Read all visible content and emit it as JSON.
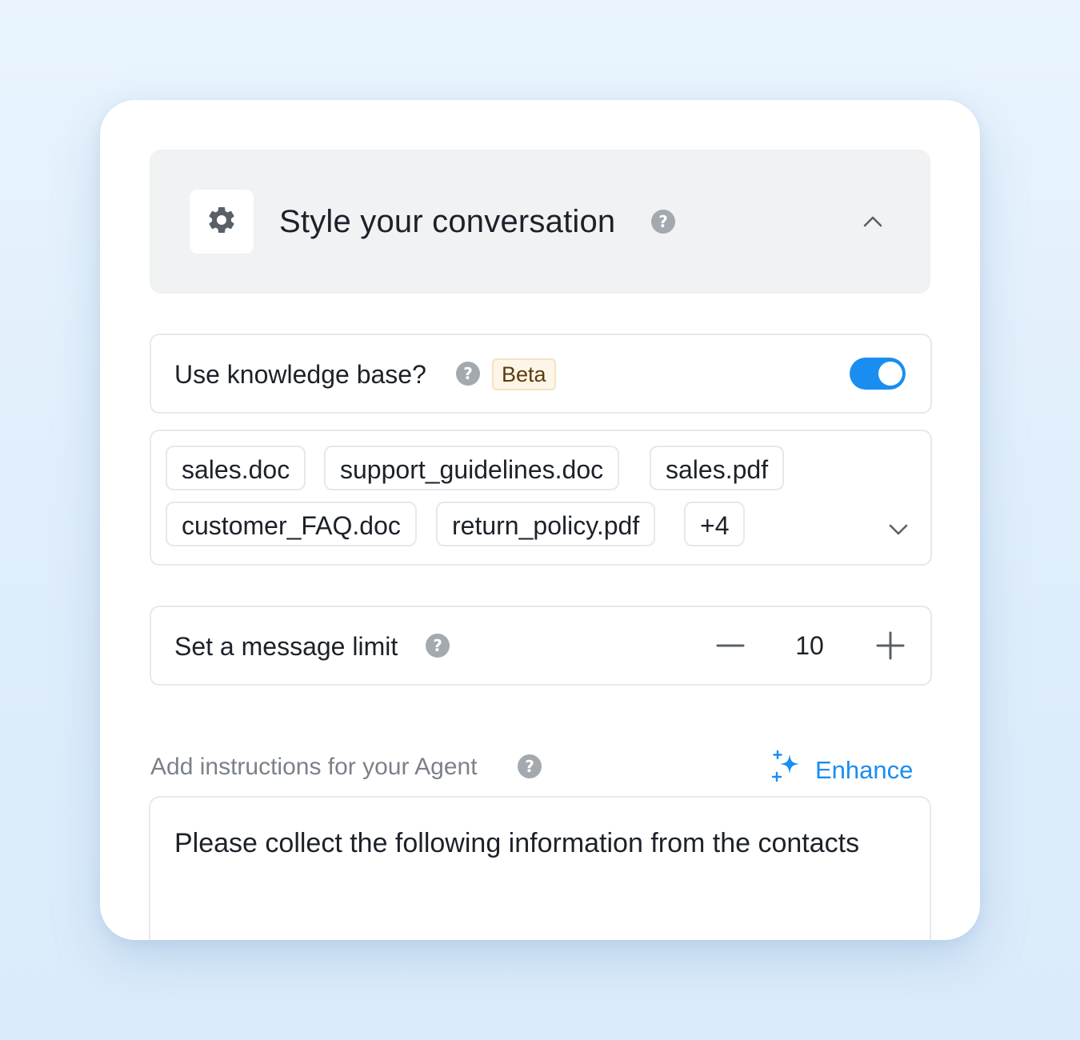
{
  "section": {
    "title": "Style your conversation",
    "help_glyph": "?",
    "icon": "gear-icon",
    "collapse_icon": "chevron-up-icon"
  },
  "knowledge_base": {
    "label": "Use knowledge base?",
    "help_glyph": "?",
    "badge": "Beta",
    "toggle_on": true,
    "accent_color": "#1a8df1"
  },
  "files": {
    "chips": [
      "sales.doc",
      "support_guidelines.doc",
      "sales.pdf",
      "customer_FAQ.doc",
      "return_policy.pdf"
    ],
    "more_label": "+4",
    "expand_icon": "chevron-down-icon"
  },
  "message_limit": {
    "label": "Set a message limit",
    "help_glyph": "?",
    "value": "10"
  },
  "instructions": {
    "label": "Add instructions for your Agent",
    "help_glyph": "?",
    "enhance_label": "Enhance",
    "enhance_icon": "sparkle-icon",
    "text": "Please collect the following information from the contacts"
  }
}
